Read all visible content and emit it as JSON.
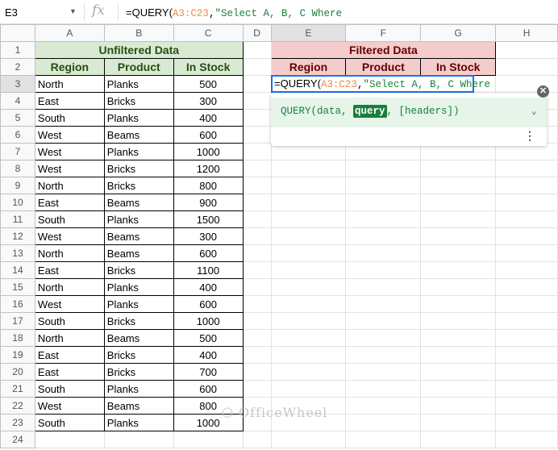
{
  "namebox": "E3",
  "formula": {
    "prefix": "=QUERY(",
    "ref": "A3:C23",
    "sep": ",",
    "str": "\"Select A, B, C Where"
  },
  "columns": [
    "A",
    "B",
    "C",
    "D",
    "E",
    "F",
    "G",
    "H"
  ],
  "left_title": "Unfiltered Data",
  "right_title": "Filtered Data",
  "headers": [
    "Region",
    "Product",
    "In Stock"
  ],
  "rows": [
    [
      "North",
      "Planks",
      "500"
    ],
    [
      "East",
      "Bricks",
      "300"
    ],
    [
      "South",
      "Planks",
      "400"
    ],
    [
      "West",
      "Beams",
      "600"
    ],
    [
      "West",
      "Planks",
      "1000"
    ],
    [
      "West",
      "Bricks",
      "1200"
    ],
    [
      "North",
      "Bricks",
      "800"
    ],
    [
      "East",
      "Beams",
      "900"
    ],
    [
      "South",
      "Planks",
      "1500"
    ],
    [
      "West",
      "Beams",
      "300"
    ],
    [
      "North",
      "Beams",
      "600"
    ],
    [
      "East",
      "Bricks",
      "1100"
    ],
    [
      "North",
      "Planks",
      "400"
    ],
    [
      "West",
      "Planks",
      "600"
    ],
    [
      "South",
      "Bricks",
      "1000"
    ],
    [
      "North",
      "Beams",
      "500"
    ],
    [
      "East",
      "Bricks",
      "400"
    ],
    [
      "East",
      "Bricks",
      "700"
    ],
    [
      "South",
      "Planks",
      "600"
    ],
    [
      "West",
      "Beams",
      "800"
    ],
    [
      "South",
      "Planks",
      "1000"
    ]
  ],
  "hint": {
    "pre": "QUERY(data, ",
    "arg": "query",
    "post": ", [headers])"
  },
  "watermark": "OfficeWheel"
}
